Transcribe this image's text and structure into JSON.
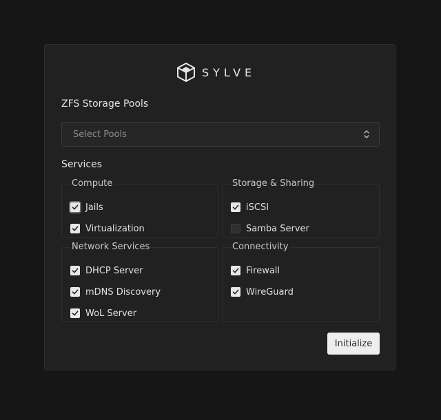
{
  "brand": {
    "name": "SYLVE",
    "logo_icon": "cube-logo-icon"
  },
  "pools": {
    "label": "ZFS Storage Pools",
    "select_placeholder": "Select Pools"
  },
  "services": {
    "label": "Services",
    "groups": [
      {
        "title": "Compute",
        "items": [
          {
            "label": "Jails",
            "checked": true
          },
          {
            "label": "Virtualization",
            "checked": true
          }
        ]
      },
      {
        "title": "Storage & Sharing",
        "items": [
          {
            "label": "iSCSI",
            "checked": true
          },
          {
            "label": "Samba Server",
            "checked": false
          }
        ]
      },
      {
        "title": "Network Services",
        "items": [
          {
            "label": "DHCP Server",
            "checked": true
          },
          {
            "label": "mDNS Discovery",
            "checked": true
          },
          {
            "label": "WoL Server",
            "checked": true
          }
        ]
      },
      {
        "title": "Connectivity",
        "items": [
          {
            "label": "Firewall",
            "checked": true
          },
          {
            "label": "WireGuard",
            "checked": true
          }
        ]
      }
    ]
  },
  "actions": {
    "initialize_label": "Initialize"
  },
  "colors": {
    "background": "#161616",
    "card": "#212121",
    "checkbox_on": "#e8e8e8",
    "button": "#eeeeee"
  }
}
